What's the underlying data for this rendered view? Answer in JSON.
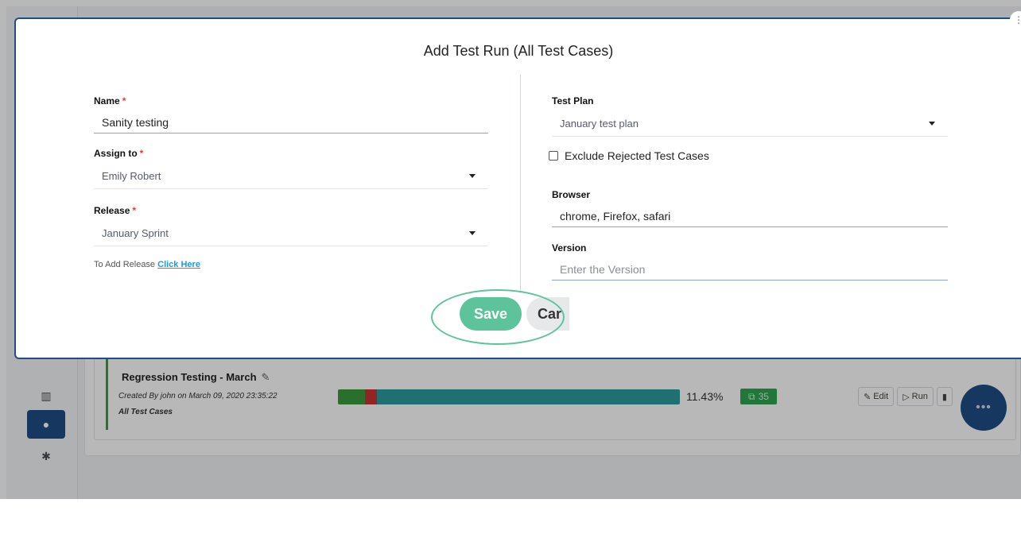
{
  "modal": {
    "title": "Add Test Run (All Test Cases)",
    "name": {
      "label": "Name",
      "required": "*",
      "value": "Sanity testing"
    },
    "assign_to": {
      "label": "Assign to",
      "required": "*",
      "value": "Emily Robert"
    },
    "release": {
      "label": "Release",
      "required": "*",
      "value": "January Sprint"
    },
    "add_release": {
      "text": "To Add Release",
      "link": "Click Here"
    },
    "test_plan": {
      "label": "Test Plan",
      "value": "January test plan"
    },
    "exclude_rejected": {
      "label": "Exclude Rejected Test Cases",
      "checked": false
    },
    "browser": {
      "label": "Browser",
      "value": "chrome, Firefox, safari"
    },
    "version": {
      "label": "Version",
      "placeholder": "Enter the Version",
      "value": ""
    },
    "save_label": "Save",
    "cancel_label": "Car"
  },
  "background": {
    "run": {
      "title": "Regression Testing - March",
      "created": "Created By john on March 09, 2020 23:35:22",
      "scope": "All Test Cases",
      "percent": "11.43%",
      "count": "35",
      "progress": {
        "pass_fraction": 0.08,
        "fail_fraction": 0.035
      },
      "edit_label": "Edit",
      "run_label": "Run"
    },
    "fab_label": "•••"
  },
  "colors": {
    "accent": "#1f4e86",
    "save": "#5dc39b",
    "link": "#1a9be6",
    "required": "#e53935"
  }
}
